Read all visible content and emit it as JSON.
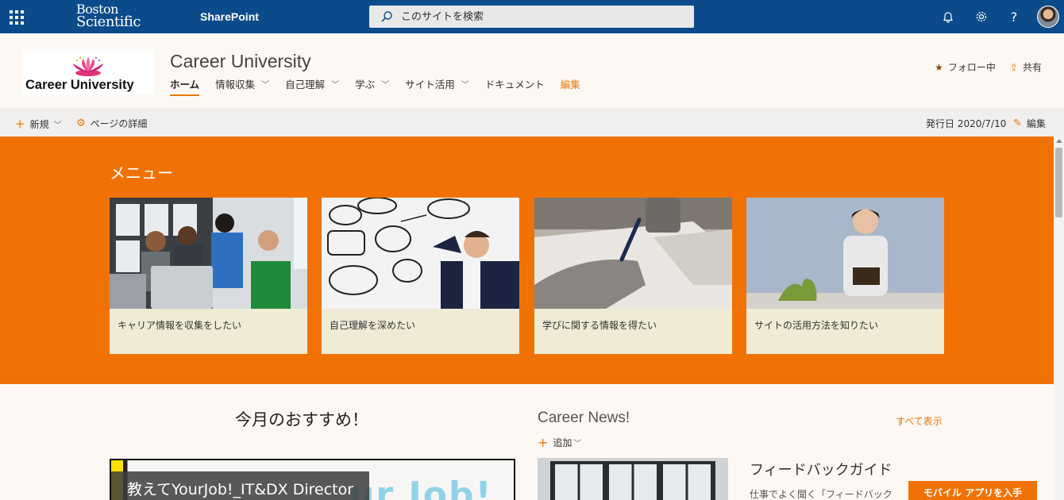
{
  "suite": {
    "brand_line1": "Boston",
    "brand_line2": "Scientific",
    "app_name": "SharePoint",
    "search_placeholder": "このサイトを検索",
    "help_label": "?"
  },
  "site": {
    "logo_text": "Career University",
    "title": "Career University",
    "nav": [
      {
        "label": "ホーム"
      },
      {
        "label": "情報収集"
      },
      {
        "label": "自己理解"
      },
      {
        "label": "学ぶ"
      },
      {
        "label": "サイト活用"
      },
      {
        "label": "ドキュメント"
      },
      {
        "label": "編集"
      }
    ],
    "follow_label": "フォロー中",
    "share_label": "共有"
  },
  "command_bar": {
    "new_label": "新規",
    "page_details_label": "ページの詳細",
    "published": "発行日 2020/7/10",
    "edit_label": "編集"
  },
  "menu": {
    "title": "メニュー",
    "cards": [
      {
        "label": "キャリア情報を収集をしたい"
      },
      {
        "label": "自己理解を深めたい"
      },
      {
        "label": "学びに関する情報を得たい"
      },
      {
        "label": "サイトの活用方法を知りたい"
      }
    ]
  },
  "recommend": {
    "title": "今月のおすすめ！",
    "video_caption": "教えてYourJob!_IT&DX Director",
    "video_art_text": "ur Job!"
  },
  "news": {
    "title": "Career News!",
    "see_all": "すべて表示",
    "add_label": "追加",
    "headline": "フィードバックガイド",
    "snippet": "仕事でよく聞く「フィードバック"
  },
  "mobile_app_button": "モバイル アプリを入手",
  "colors": {
    "suite_bar": "#0b4b8a",
    "accent": "#f07205",
    "card_bg": "#efebd4"
  }
}
